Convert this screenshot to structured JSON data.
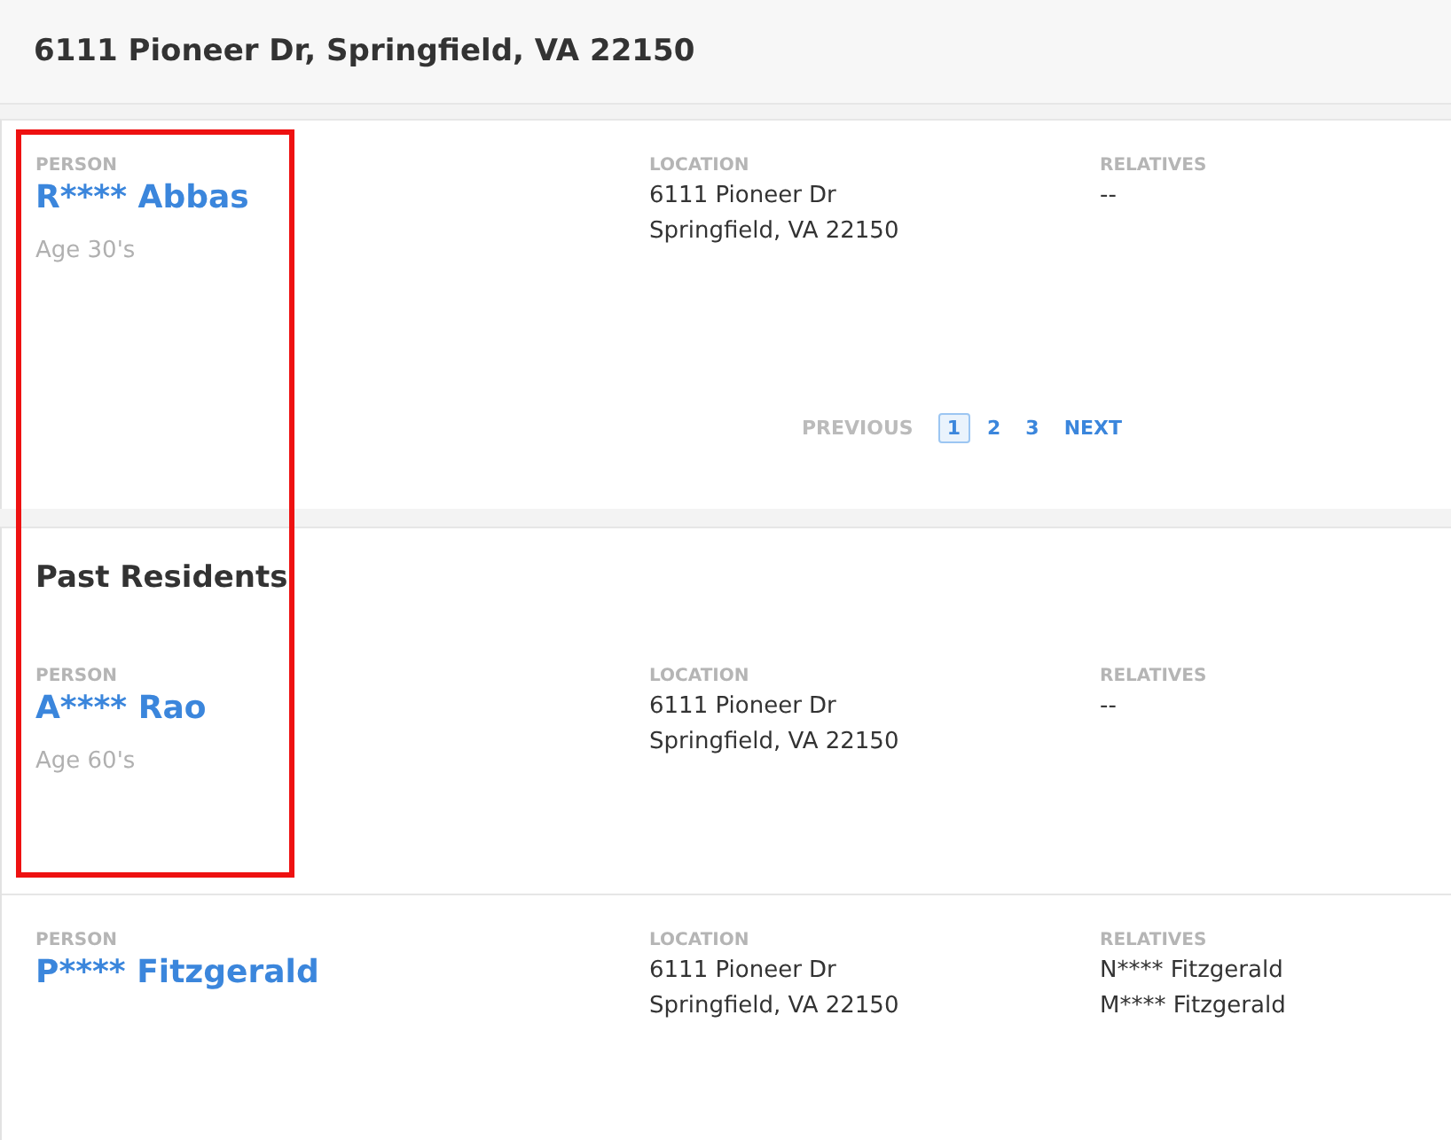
{
  "header": {
    "title": "6111 Pioneer Dr, Springfield, VA 22150"
  },
  "current_residents": {
    "records": [
      {
        "person_label": "PERSON",
        "name": "R**** Abbas",
        "age": "Age 30's",
        "location_label": "LOCATION",
        "location_lines": [
          "6111 Pioneer Dr",
          "Springfield, VA 22150"
        ],
        "relatives_label": "RELATIVES",
        "relatives": [
          "--"
        ]
      }
    ],
    "pagination": {
      "previous": {
        "label": "PREVIOUS",
        "disabled": true
      },
      "pages": [
        {
          "label": "1",
          "selected": true
        },
        {
          "label": "2",
          "selected": false
        },
        {
          "label": "3",
          "selected": false
        }
      ],
      "next": {
        "label": "NEXT",
        "disabled": false
      }
    }
  },
  "past_residents": {
    "title": "Past Residents",
    "records": [
      {
        "person_label": "PERSON",
        "name": "A**** Rao",
        "age": "Age 60's",
        "location_label": "LOCATION",
        "location_lines": [
          "6111 Pioneer Dr",
          "Springfield, VA 22150"
        ],
        "relatives_label": "RELATIVES",
        "relatives": [
          "--"
        ]
      },
      {
        "person_label": "PERSON",
        "name": "P**** Fitzgerald",
        "location_label": "LOCATION",
        "location_lines": [
          "6111 Pioneer Dr",
          "Springfield, VA 22150"
        ],
        "relatives_label": "RELATIVES",
        "relatives": [
          "N**** Fitzgerald",
          "M**** Fitzgerald"
        ]
      }
    ]
  }
}
